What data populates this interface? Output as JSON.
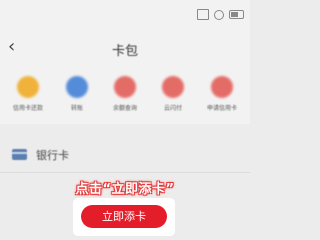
{
  "header": {
    "title": "卡包",
    "back_icon": "chevron-left-icon"
  },
  "status_bar": {
    "icons": [
      "message-icon",
      "notification-icon",
      "battery-icon"
    ]
  },
  "shortcuts": [
    {
      "label": "信用卡还款",
      "icon": "credit-repay-icon",
      "color": "#f0a81a"
    },
    {
      "label": "转账",
      "icon": "transfer-icon",
      "color": "#3a7bd5"
    },
    {
      "label": "余额查询",
      "icon": "balance-query-icon",
      "color": "#e2554f"
    },
    {
      "label": "云闪付",
      "icon": "quickpay-icon",
      "color": "#e2554f"
    },
    {
      "label": "申请信用卡",
      "icon": "apply-card-icon",
      "color": "#e2554f"
    }
  ],
  "bank_card_section": {
    "label": "银行卡",
    "icon": "bank-card-icon"
  },
  "annotation": {
    "hint": "点击“立即添卡”"
  },
  "add_card_button": {
    "label": "立即添卡",
    "color": "#e41d2a"
  }
}
